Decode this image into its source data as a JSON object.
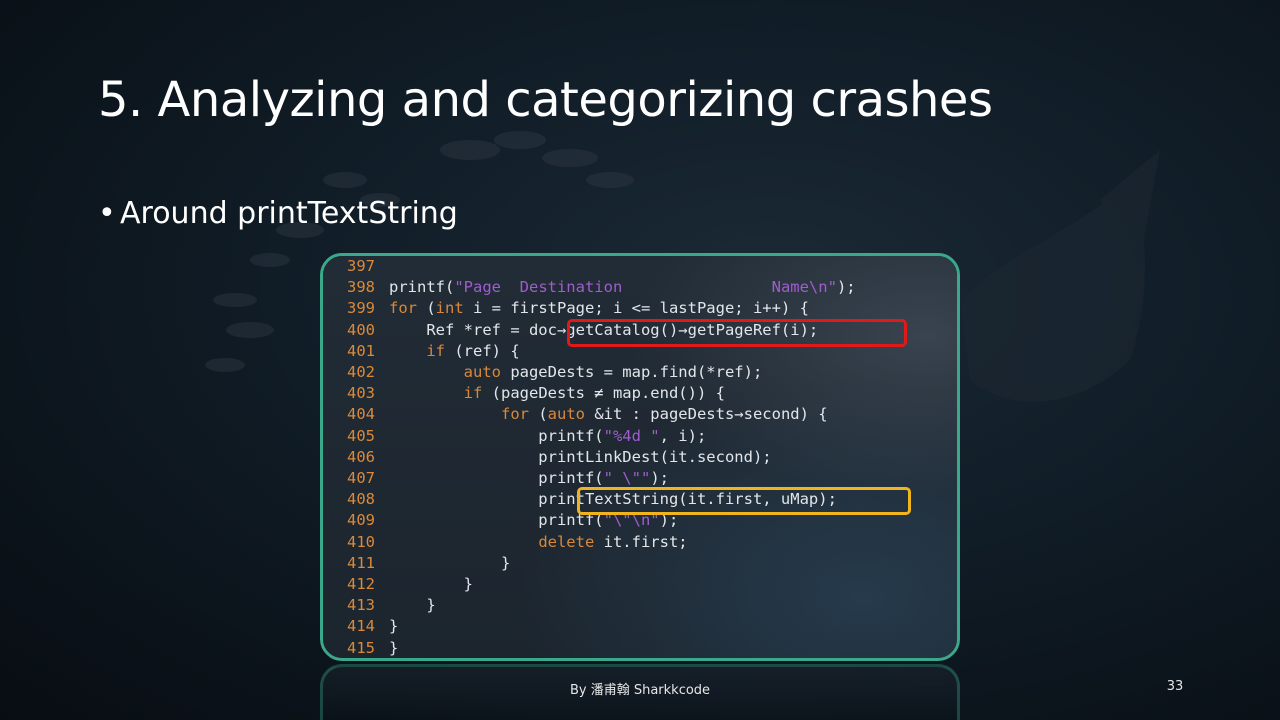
{
  "slide": {
    "title": "5. Analyzing and categorizing crashes",
    "bullet": "Around printTextString",
    "bullet_marker": "•",
    "footer": "By 潘甫翰 Sharkkcode",
    "page_number": "33"
  },
  "code": {
    "lines": [
      {
        "num": "397",
        "text": ""
      },
      {
        "num": "398",
        "text": "printf(\"Page  Destination                Name\\n\");"
      },
      {
        "num": "399",
        "text": "for (int i = firstPage; i <= lastPage; i++) {"
      },
      {
        "num": "400",
        "text": "    Ref *ref = doc→getCatalog()→getPageRef(i);"
      },
      {
        "num": "401",
        "text": "    if (ref) {"
      },
      {
        "num": "402",
        "text": "        auto pageDests = map.find(*ref);"
      },
      {
        "num": "403",
        "text": "        if (pageDests ≠ map.end()) {"
      },
      {
        "num": "404",
        "text": "            for (auto &it : pageDests→second) {"
      },
      {
        "num": "405",
        "text": "                printf(\"%4d \", i);"
      },
      {
        "num": "406",
        "text": "                printLinkDest(it.second);"
      },
      {
        "num": "407",
        "text": "                printf(\" \\\"\");"
      },
      {
        "num": "408",
        "text": "                printTextString(it.first, uMap);"
      },
      {
        "num": "409",
        "text": "                printf(\"\\\"\\n\");"
      },
      {
        "num": "410",
        "text": "                delete it.first;"
      },
      {
        "num": "411",
        "text": "            }"
      },
      {
        "num": "412",
        "text": "        }"
      },
      {
        "num": "413",
        "text": "    }"
      },
      {
        "num": "414",
        "text": "}"
      },
      {
        "num": "415",
        "text": "}"
      }
    ],
    "highlights": [
      {
        "line": "400",
        "text": "doc→getCatalog()→getPageRef(i);",
        "color": "#e01919"
      },
      {
        "line": "408",
        "text": "printTextString(it.first, uMap);",
        "color": "#f0b51d"
      }
    ]
  },
  "colors": {
    "frame_border": "#3aa88b",
    "line_number": "#d98a3a",
    "keyword": "#d9883a",
    "string": "#a05cd0",
    "code_text": "#e2e6ea"
  }
}
